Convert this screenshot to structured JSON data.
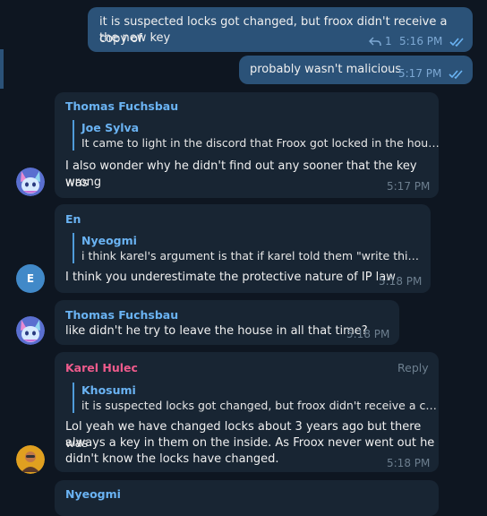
{
  "messages": [
    {
      "text_line1": "it is suspected locks got changed, but froox didn't receive a copy of",
      "text_line2": "the new key",
      "reply_count": "1",
      "time": "5:16 PM"
    },
    {
      "text": "probably wasn't malicious",
      "time": "5:17 PM"
    },
    {
      "sender": "Thomas Fuchsbau",
      "quote_name": "Joe Sylva",
      "quote_text": "It came to light in the discord that Froox got locked in the house ...",
      "text_line1": "I also wonder why he didn't find out any sooner that the key was",
      "text_line2": "wrong",
      "time": "5:17 PM"
    },
    {
      "sender": "En",
      "avatar_letter": "E",
      "quote_name": "Nyeogmi",
      "quote_text": "i think karel's argument is that if karel told them  \"write this thi...",
      "text": "I think you underestimate the protective nature of IP law",
      "time": "5:18 PM"
    },
    {
      "sender": "Thomas Fuchsbau",
      "text": "like didn't he try to leave the house in all that time?",
      "time": "5:18 PM"
    },
    {
      "sender": "Karel Hulec",
      "reply_label": "Reply",
      "quote_name": "Khosumi",
      "quote_text": "it is suspected locks got changed, but froox didn't receive a copy ...",
      "text_line1": "Lol yeah we have changed locks about 3 years ago but there was",
      "text_line2": "always a key in them on the inside. As Froox never went out he",
      "text_line3": "didn't know the locks have changed.",
      "time": "5:18 PM"
    },
    {
      "sender": "Nyeogmi"
    }
  ],
  "colors": {
    "background": "#0e1621",
    "outgoing_bubble": "#2b5278",
    "incoming_bubble": "#182533",
    "name_blue": "#6ab3f3",
    "name_pink": "#ee5b8c",
    "read_checks": "#6ab3f3"
  },
  "icons": [
    "reply-arrow-icon",
    "double-check-icon",
    "thomas-fox-avatar",
    "karel-avatar"
  ]
}
